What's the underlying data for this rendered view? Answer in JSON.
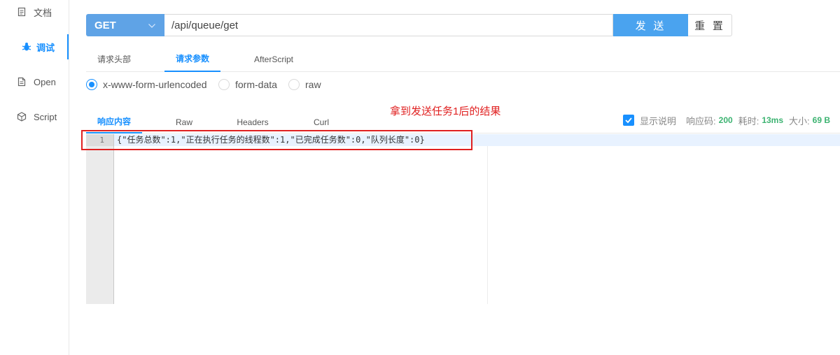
{
  "sidebar": {
    "items": [
      {
        "label": "文档",
        "icon": "document-icon"
      },
      {
        "label": "调试",
        "icon": "bug-icon",
        "active": true
      },
      {
        "label": "Open",
        "icon": "file-icon"
      },
      {
        "label": "Script",
        "icon": "cube-icon"
      }
    ]
  },
  "request": {
    "method": "GET",
    "url": "/api/queue/get",
    "send_label": "发 送",
    "reset_label": "重 置"
  },
  "request_tabs": [
    "请求头部",
    "请求参数",
    "AfterScript"
  ],
  "request_active_tab": "请求参数",
  "body_types": [
    {
      "label": "x-www-form-urlencoded",
      "checked": true
    },
    {
      "label": "form-data",
      "checked": false
    },
    {
      "label": "raw",
      "checked": false
    }
  ],
  "annotation": "拿到发送任务1后的结果",
  "response_tabs": [
    "响应内容",
    "Raw",
    "Headers",
    "Curl"
  ],
  "response_active_tab": "响应内容",
  "response_meta": {
    "show_desc_label": "显示说明",
    "show_desc_checked": true,
    "status_label": "响应码:",
    "status_value": "200",
    "time_label": "耗时:",
    "time_value": "13ms",
    "size_label": "大小:",
    "size_value": "69 B"
  },
  "editor": {
    "line_number": "1",
    "code": "{\"任务总数\":1,\"正在执行任务的线程数\":1,\"已完成任务数\":0,\"队列长度\":0}"
  },
  "colors": {
    "accent": "#1890ff",
    "method_bg": "#5fa3e6",
    "send_bg": "#4aa3ef",
    "annotation": "#e02020",
    "success": "#3cb371"
  }
}
